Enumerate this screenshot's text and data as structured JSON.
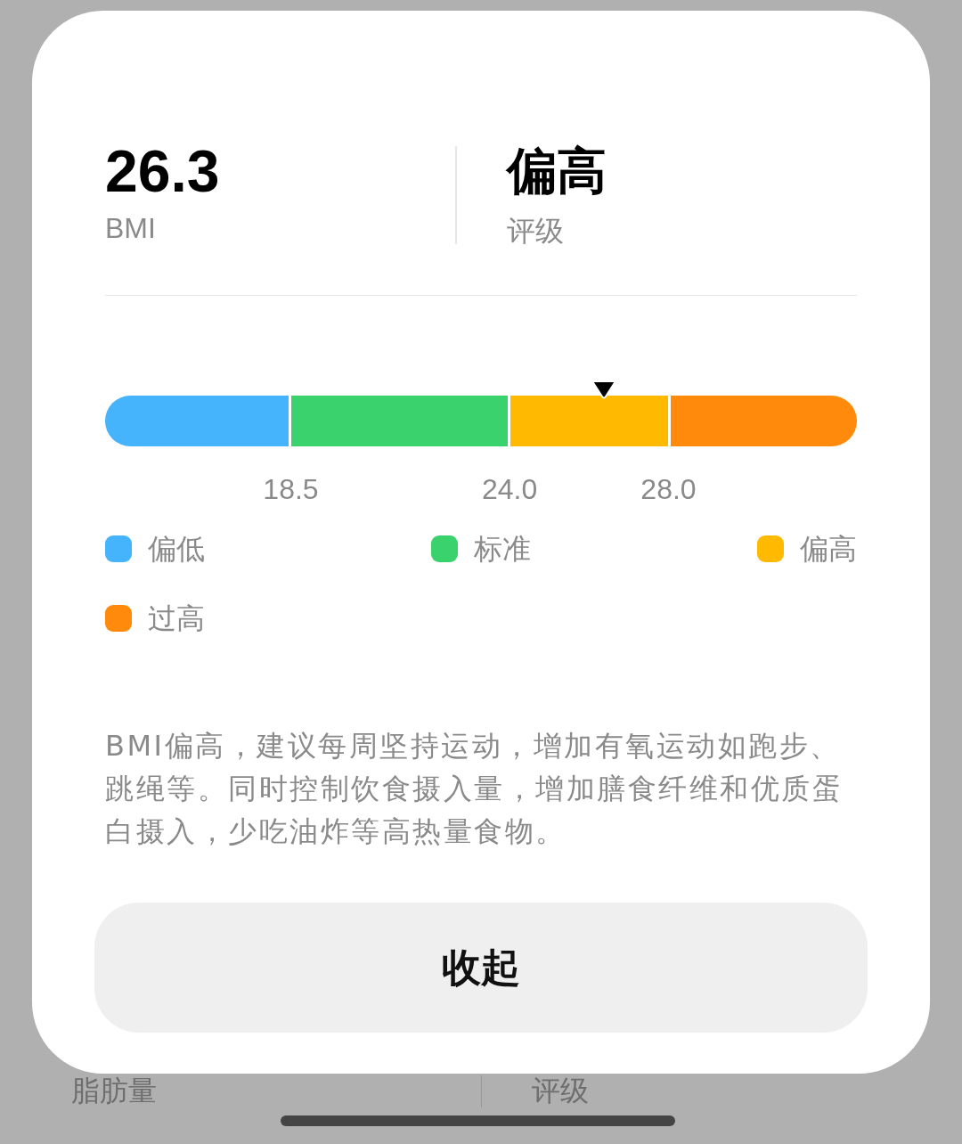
{
  "summary": [
    {
      "value": "26.3",
      "label": "BMI"
    },
    {
      "value": "偏高",
      "label": "评级"
    }
  ],
  "bmi_scale": {
    "level": 0.663,
    "segments": [
      {
        "color": "#46b3fd"
      },
      {
        "color": "#3ad26d"
      },
      {
        "color": "#ffba00"
      },
      {
        "color": "#ff8a0c"
      }
    ],
    "ticks": [
      "18.5",
      "24.0",
      "28.0"
    ]
  },
  "legend": [
    {
      "label": "偏低",
      "color": "#46b3fd"
    },
    {
      "label": "标准",
      "color": "#3ad26d"
    },
    {
      "label": "偏高",
      "color": "#ffba00"
    },
    {
      "label": "过高",
      "color": "#ff8a0c"
    }
  ],
  "advice": "BMI偏高，建议每周坚持运动，增加有氧运动如跑步、跳绳等。同时控制饮食摄入量，增加膳食纤维和优质蛋白摄入，少吃油炸等高热量食物。",
  "collapse_button": "收起",
  "background_row": {
    "left": "脂肪量",
    "right": "评级"
  }
}
